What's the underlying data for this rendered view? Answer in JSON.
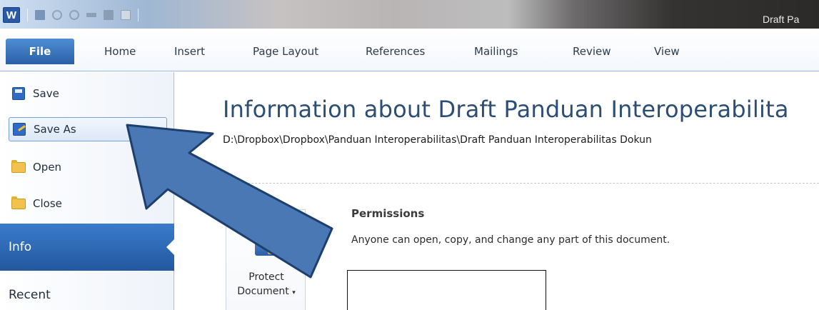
{
  "app": {
    "logo_letter": "W",
    "window_title": "Draft Pa"
  },
  "ribbon": {
    "tabs": [
      "File",
      "Home",
      "Insert",
      "Page Layout",
      "References",
      "Mailings",
      "Review",
      "View"
    ]
  },
  "backstage_nav": {
    "commands": [
      "Save",
      "Save As",
      "Open",
      "Close"
    ],
    "active": "Info",
    "recent": "Recent"
  },
  "info": {
    "title": "Information about Draft Panduan Interoperabilita",
    "path": "D:\\Dropbox\\Dropbox\\Panduan Interoperabilitas\\Draft Panduan Interoperabilitas Dokun",
    "protect_label_line1": "Protect",
    "protect_label_line2": "Document",
    "permissions_title": "Permissions",
    "permissions_desc": "Anyone can open, copy, and change any part of this document."
  },
  "colors": {
    "accent": "#2a5fa8",
    "arrow_fill": "#4a78b5",
    "arrow_stroke": "#1d3f6e"
  },
  "icons": [
    "word-logo",
    "save-icon",
    "undo-icon",
    "redo-icon",
    "save-as-icon",
    "open-folder-icon",
    "close-folder-icon",
    "protect-document-icon"
  ]
}
